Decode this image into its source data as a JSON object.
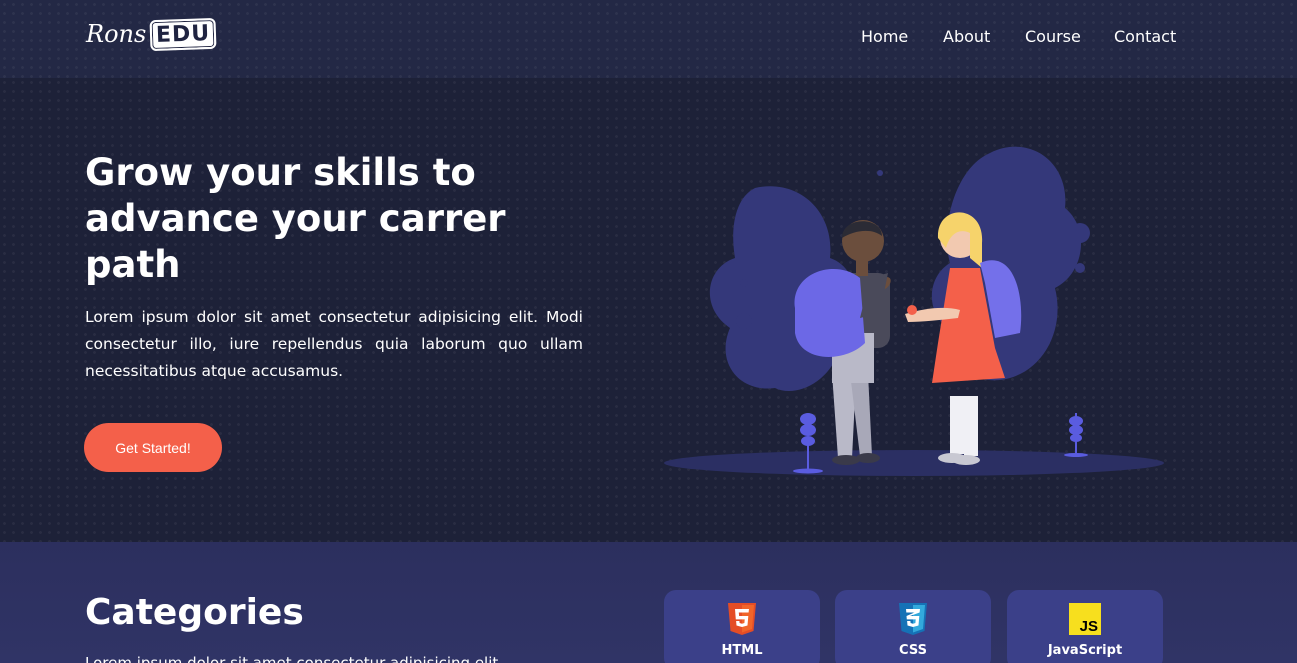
{
  "header": {
    "logo_script": "Rons",
    "logo_block": "EDU",
    "nav": [
      {
        "label": "Home"
      },
      {
        "label": "About"
      },
      {
        "label": "Course"
      },
      {
        "label": "Contact"
      }
    ]
  },
  "hero": {
    "title": "Grow your skills to advance your carrer path",
    "text": "Lorem ipsum dolor sit amet consectetur adipisicing elit. Modi consectetur illo, iure repellendus quia laborum quo ullam necessitatibus atque accusamus.",
    "cta_label": "Get Started!"
  },
  "categories": {
    "title": "Categories",
    "subtitle": "Lorem ipsum dolor sit amet consectetur adipisicing elit.",
    "cards": [
      {
        "label": "HTML",
        "icon": "html5-icon",
        "color": "#e44d26"
      },
      {
        "label": "CSS",
        "icon": "css3-icon",
        "color": "#2965f1"
      },
      {
        "label": "JavaScript",
        "icon": "javascript-icon",
        "color": "#f7df1e"
      }
    ]
  },
  "colors": {
    "accent": "#f4604a",
    "illustration_purple": "#5a5ce0",
    "card_bg": "#3b4089"
  }
}
